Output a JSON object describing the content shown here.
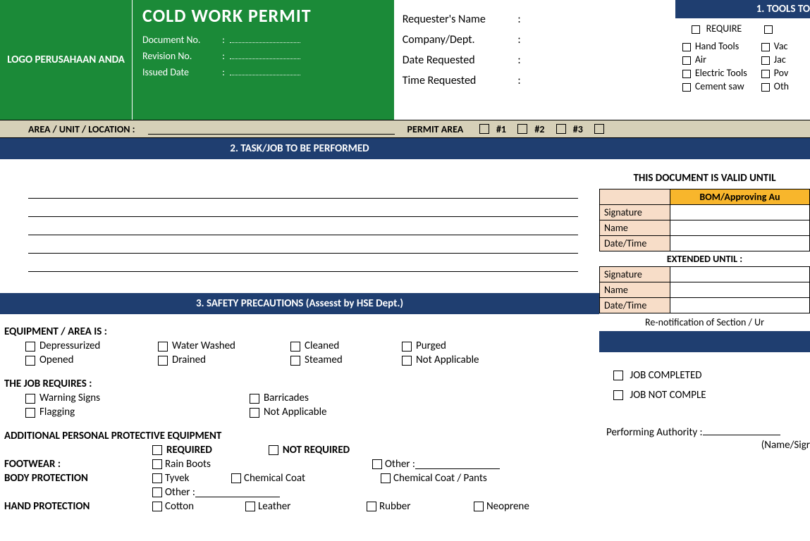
{
  "header": {
    "logo_text": "LOGO PERUSAHAAN ANDA",
    "title": "COLD WORK PERMIT",
    "doc_no_label": "Document No.",
    "rev_no_label": "Revision No.",
    "issued_label": "Issued Date",
    "requester": "Requester's Name",
    "company": "Company/Dept.",
    "date_req": "Date Requested",
    "time_req": "Time Requested",
    "colon": ":"
  },
  "tools": {
    "section_title": "1. TOOLS TO",
    "require": "REQUIRE",
    "col1": [
      "Hand Tools",
      "Air",
      "Electric Tools",
      "Cement saw"
    ],
    "col2": [
      "Vac",
      "Jac",
      "Pov",
      "Oth"
    ]
  },
  "area": {
    "label": "AREA / UNIT / LOCATION   :",
    "permit": "PERMIT AREA",
    "n1": "#1",
    "n2": "#2",
    "n3": "#3"
  },
  "sections": {
    "task": "2. TASK/JOB TO BE PERFORMED",
    "safety": "3. SAFETY PRECAUTIONS  (Assesst by HSE Dept.)"
  },
  "safety": {
    "equip_title": "EQUIPMENT / AREA IS :",
    "equip_items": [
      "Depressurized",
      "Water Washed",
      "Cleaned",
      "Purged",
      "Opened",
      "Drained",
      "Steamed",
      "Not Applicable"
    ],
    "job_title": "THE JOB REQUIRES :",
    "job_items": [
      "Warning Signs",
      "Barricades",
      "Flagging",
      "Not Applicable"
    ],
    "ppe_title": "ADDITIONAL PERSONAL PROTECTIVE EQUIPMENT",
    "required": "REQUIRED",
    "not_required": "NOT REQUIRED",
    "footwear_label": "FOOTWEAR :",
    "footwear": [
      "Rain Boots"
    ],
    "other": "Other :",
    "body_label": "BODY PROTECTION",
    "body1": [
      "Tyvek",
      "Chemical Coat",
      "Chemical Coat / Pants"
    ],
    "body2_other": "Other :",
    "hand_label": "HAND PROTECTION",
    "hand": [
      "Cotton",
      "Leather",
      "Rubber",
      "Neoprene"
    ]
  },
  "right": {
    "valid_title": "THIS DOCUMENT IS VALID UNTIL",
    "bom": "BOM/Approving Au",
    "sig": "Signature",
    "name": "Name",
    "dt": "Date/Time",
    "extended": "EXTENDED UNTIL :",
    "renotif": "Re-notification of Section / Ur",
    "job_completed": "JOB COMPLETED",
    "job_not_completed": "JOB NOT COMPLE",
    "perf_auth": "Performing Authority :",
    "name_sig": "(Name/Sigr"
  }
}
